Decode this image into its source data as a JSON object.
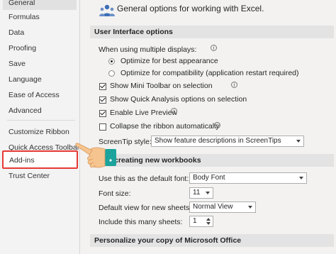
{
  "sidebar": {
    "items": [
      {
        "label": "General"
      },
      {
        "label": "Formulas"
      },
      {
        "label": "Data"
      },
      {
        "label": "Proofing"
      },
      {
        "label": "Save"
      },
      {
        "label": "Language"
      },
      {
        "label": "Ease of Access"
      },
      {
        "label": "Advanced"
      },
      {
        "label": "Customize Ribbon"
      },
      {
        "label": "Quick Access Toolbar"
      },
      {
        "label": "Add-ins"
      },
      {
        "label": "Trust Center"
      }
    ]
  },
  "header": {
    "description": "General options for working with Excel."
  },
  "ui_options": {
    "title": "User Interface options",
    "multi_display_label": "When using multiple displays:",
    "radio_best": "Optimize for best appearance",
    "radio_compat": "Optimize for compatibility (application restart required)",
    "show_mini_toolbar": "Show Mini Toolbar on selection",
    "show_quick_analysis": "Show Quick Analysis options on selection",
    "enable_live_preview": "Enable Live Preview",
    "collapse_ribbon": "Collapse the ribbon automatically",
    "screentip_label": "ScreenTip style:",
    "screentip_value": "Show feature descriptions in ScreenTips"
  },
  "workbook_options": {
    "title": "creating new workbooks",
    "default_font_label": "Use this as the default font:",
    "default_font_value": "Body Font",
    "font_size_label": "Font size:",
    "font_size_value": "11",
    "default_view_label": "Default view for new sheets:",
    "default_view_value": "Normal View",
    "sheets_label": "Include this many sheets:",
    "sheets_value": "1"
  },
  "personalize": {
    "title": "Personalize your copy of Microsoft Office"
  },
  "colors": {
    "highlight_border": "#e53935",
    "hand_cuff": "#1ba39c",
    "hand_skin": "#f6c48e"
  },
  "icons": [
    "general-options-icon",
    "info-icon",
    "pointing-hand-icon"
  ]
}
